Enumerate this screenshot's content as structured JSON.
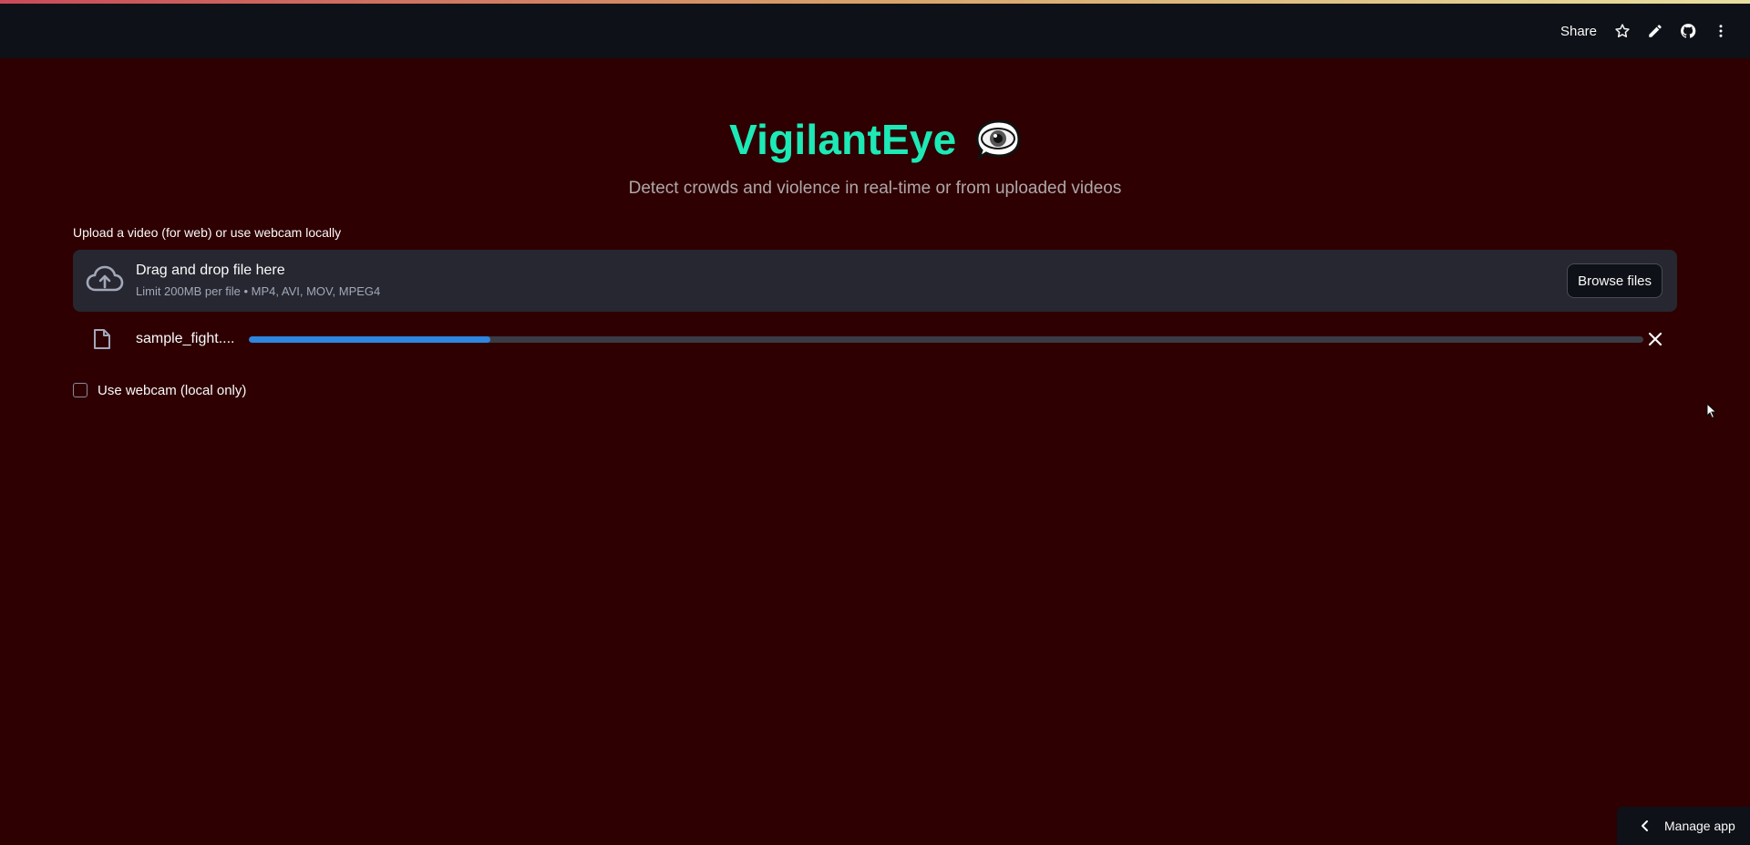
{
  "header": {
    "share_label": "Share",
    "icons": [
      "star-icon",
      "pencil-icon",
      "github-icon",
      "more-vertical-icon"
    ]
  },
  "app": {
    "title": "VigilantEye",
    "title_emoji": "eye-in-speech-bubble",
    "subtitle": "Detect crowds and violence in real-time or from uploaded videos",
    "title_color": "#1de9b6"
  },
  "uploader": {
    "label": "Upload a video (for web) or use webcam locally",
    "dropzone_title": "Drag and drop file here",
    "dropzone_limits": "Limit 200MB per file • MP4, AVI, MOV, MPEG4",
    "browse_label": "Browse files"
  },
  "file": {
    "name": "sample_fight....",
    "progress": 0.173,
    "progress_color": "#2e86de"
  },
  "webcam": {
    "label": "Use webcam (local only)",
    "checked": false
  },
  "footer": {
    "manage_label": "Manage app"
  },
  "colors": {
    "background": "#2e0002",
    "header": "#0e1117",
    "dropzone": "#262730"
  }
}
